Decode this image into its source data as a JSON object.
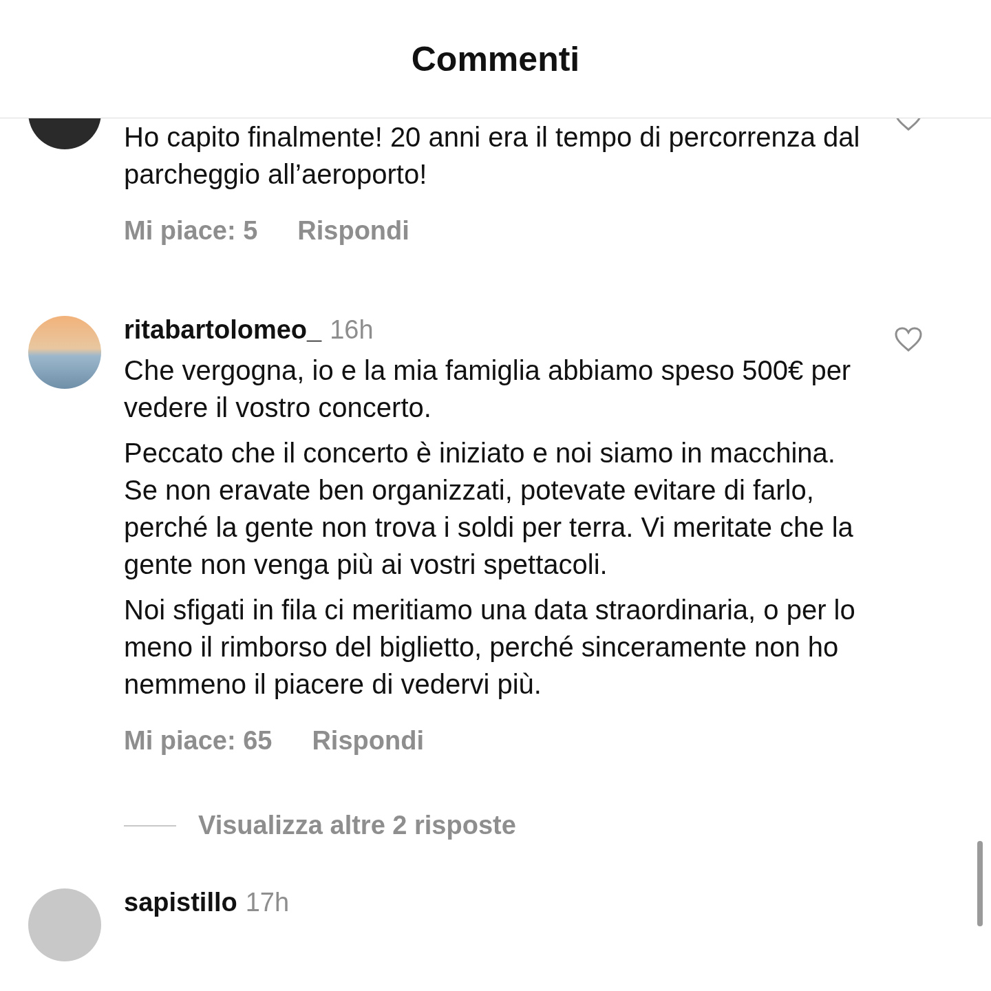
{
  "header": {
    "title": "Commenti"
  },
  "comments": [
    {
      "paragraphs": [
        "Ho capito finalmente! 20 anni era il tempo di percorrenza dal parcheggio all’aeroporto!"
      ],
      "likes": "Mi piace: 5",
      "reply": "Rispondi",
      "liked": false
    },
    {
      "username": "ritabartolomeo_",
      "time": "16h",
      "paragraphs": [
        "Che vergogna, io e la mia famiglia abbiamo speso 500€ per vedere il vostro concerto.",
        "Peccato che il concerto è iniziato e noi siamo in macchina. Se non eravate ben organizzati, potevate evitare di farlo, perché la gente non trova i soldi per terra.  Vi meritate che la gente non venga più ai vostri spettacoli.",
        "Noi sfigati in fila ci meritiamo una data straordinaria, o per lo meno il rimborso del biglietto, perché sinceramente non ho nemmeno il piacere di vedervi più."
      ],
      "likes": "Mi piace: 65",
      "reply": "Rispondi",
      "liked": false,
      "view_replies": "Visualizza altre 2 risposte"
    },
    {
      "username": "sapistillo",
      "time": "17h"
    }
  ]
}
